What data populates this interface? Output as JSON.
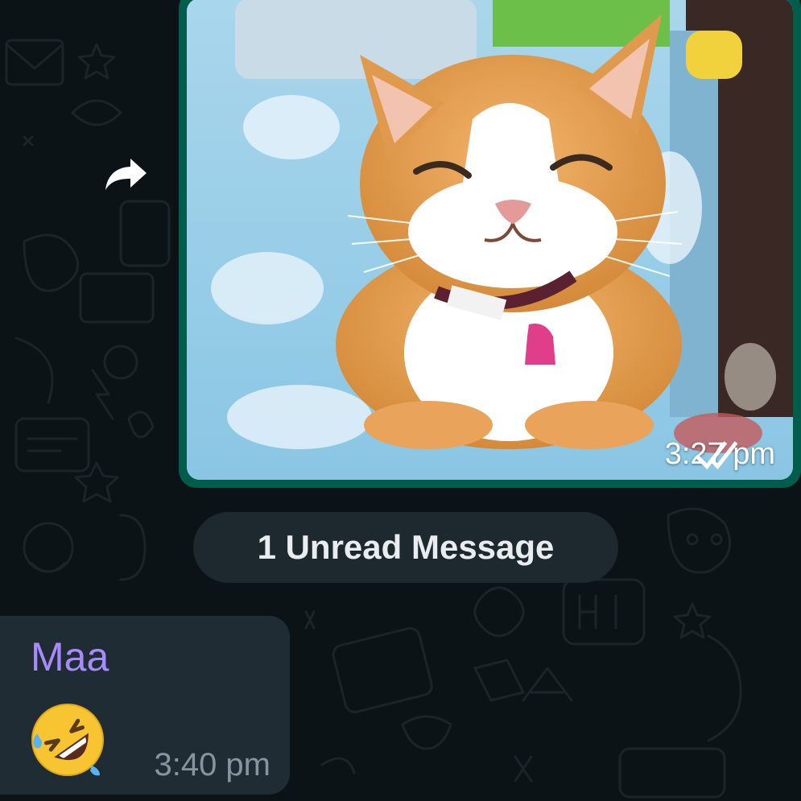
{
  "colors": {
    "background": "#0c1317",
    "outgoing_bubble": "#005c4b",
    "incoming_bubble": "#1f2c33",
    "pill": "#1d282f",
    "sender_name": "#a78bfa",
    "meta_text": "#8696a0"
  },
  "icons": {
    "forward": "forward-arrow-icon",
    "double_check": "double-check-icon",
    "emoji": "rolling-on-floor-laughing"
  },
  "chat": {
    "image_message": {
      "image_description": "smiling orange and white cat",
      "time": "3:27 pm"
    },
    "unread_divider": "1 Unread Message",
    "incoming_message": {
      "sender": "Maa",
      "emoji": "🤣",
      "time": "3:40 pm"
    }
  }
}
